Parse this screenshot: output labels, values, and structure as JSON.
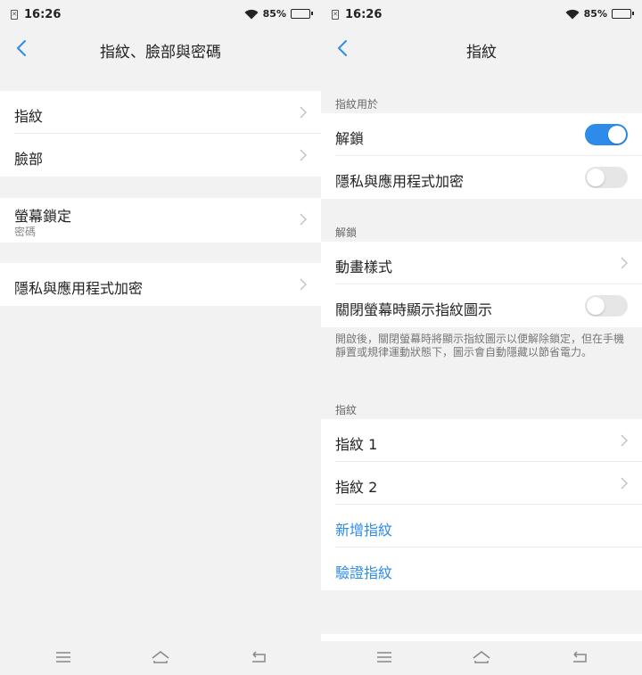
{
  "status": {
    "time": "16:26",
    "battery": "85%",
    "battery_level": 0.85
  },
  "left": {
    "title": "指紋、臉部與密碼",
    "items": [
      {
        "label": "指紋"
      },
      {
        "label": "臉部"
      },
      {
        "label": "螢幕鎖定",
        "sub": "密碼"
      },
      {
        "label": "隱私與應用程式加密"
      }
    ]
  },
  "right": {
    "title": "指紋",
    "section_usage": "指紋用於",
    "unlock_label": "解鎖",
    "unlock_on": true,
    "privacy_label": "隱私與應用程式加密",
    "privacy_on": false,
    "section_unlock": "解鎖",
    "animation_label": "動畫樣式",
    "show_icon_label": "關閉螢幕時顯示指紋圖示",
    "show_icon_on": false,
    "note": "開啟後，關閉螢幕時將顯示指紋圖示以便解除鎖定，但在手機靜置或規律運動狀態下，圖示會自動隱藏以節省電力。",
    "section_fingerprint": "指紋",
    "fingerprints": [
      {
        "label": "指紋 1"
      },
      {
        "label": "指紋 2"
      }
    ],
    "add_label": "新增指紋",
    "verify_label": "驗證指紋"
  },
  "colors": {
    "accent": "#2d8bea",
    "background": "#f2f2f2",
    "row": "#ffffff"
  },
  "icons": [
    "wifi-icon",
    "battery-icon",
    "sim-icon",
    "back-icon",
    "chevron-right-icon",
    "menu-icon",
    "home-icon",
    "return-icon"
  ]
}
